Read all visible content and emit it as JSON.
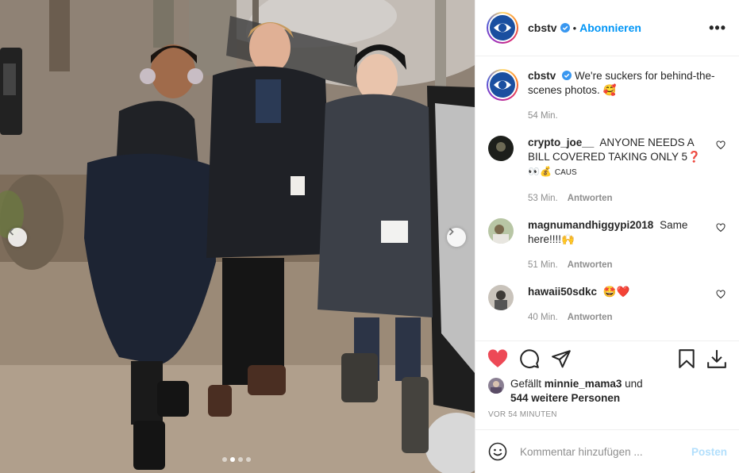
{
  "post": {
    "author": "cbstv",
    "separator": "•",
    "follow_label": "Abonnieren",
    "more_label": "•••",
    "carousel_dots": 4,
    "active_dot": 1
  },
  "caption": {
    "user": "cbstv",
    "text": "We're suckers for behind-the-scenes photos. 🥰",
    "time": "54 Min."
  },
  "comments": [
    {
      "user": "crypto_joe__",
      "text": "ANYONE NEEDS A BILL COVERED TAKING ONLY 5❓",
      "text2": "👀💰",
      "text2_suffix": "CAUS",
      "time": "53 Min.",
      "reply": "Antworten"
    },
    {
      "user": "magnumandhiggypi2018",
      "text": "Same here!!!!🙌",
      "time": "51 Min.",
      "reply": "Antworten"
    },
    {
      "user": "hawaii50sdkc",
      "text": "🤩❤️",
      "time": "40 Min.",
      "reply": "Antworten"
    }
  ],
  "likes": {
    "prefix": "Gefällt",
    "user": "minnie_mama3",
    "and": "und",
    "count": "544 weitere Personen"
  },
  "timestamp": "VOR 54 MINUTEN",
  "add_comment": {
    "placeholder": "Kommentar hinzufügen ...",
    "post_label": "Posten"
  },
  "colors": {
    "link_blue": "#0095f6",
    "like_red": "#ed4956",
    "post_disabled": "#b2dffc"
  },
  "icons": [
    "heart-icon",
    "comment-icon",
    "share-icon",
    "bookmark-icon",
    "download-icon",
    "emoji-icon",
    "verified-icon",
    "chevron-left-icon",
    "chevron-right-icon"
  ]
}
